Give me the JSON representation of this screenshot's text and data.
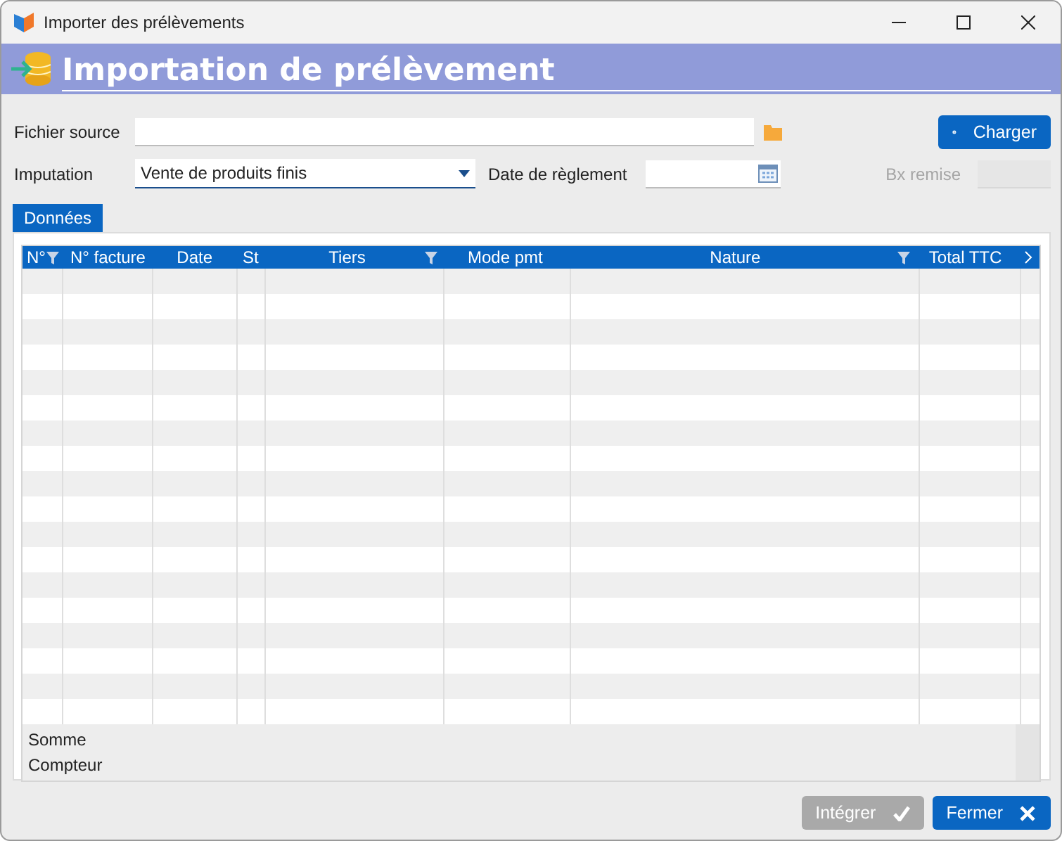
{
  "window": {
    "title": "Importer des prélèvements"
  },
  "banner": {
    "title": "Importation de prélèvement"
  },
  "fields": {
    "source": {
      "label": "Fichier source"
    },
    "imputation": {
      "label": "Imputation",
      "value": "Vente de produits finis"
    },
    "date": {
      "label": "Date de règlement"
    },
    "bx_remise": {
      "label": "Bx remise",
      "disabled": true
    }
  },
  "load_button": {
    "label": "Charger"
  },
  "tabs": [
    {
      "label": "Données",
      "selected": true
    }
  ],
  "table": {
    "columns": [
      {
        "label": "N°",
        "filter": true
      },
      {
        "label": "N° facture",
        "filter": false
      },
      {
        "label": "Date",
        "filter": false
      },
      {
        "label": "St",
        "filter": false
      },
      {
        "label": "Tiers",
        "filter": true
      },
      {
        "label": "Mode pmt",
        "filter": false
      },
      {
        "label": "Nature",
        "filter": true
      },
      {
        "label": "Total TTC",
        "filter": false
      }
    ],
    "footer": [
      "Somme",
      "Compteur"
    ]
  },
  "buttons": [
    {
      "label": "Intégrer",
      "kind": "check",
      "disabled": true
    },
    {
      "label": "Fermer",
      "kind": "close",
      "disabled": false
    }
  ]
}
